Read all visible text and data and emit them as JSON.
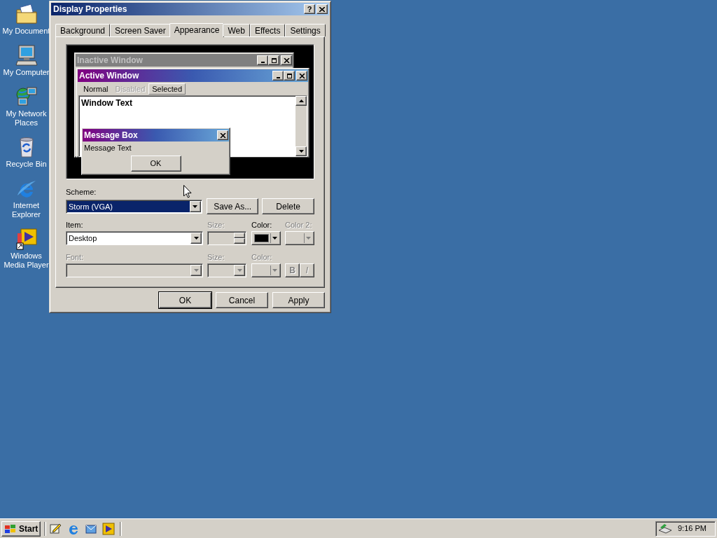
{
  "desktop_icons": [
    {
      "kind": "documents",
      "label": "My Document"
    },
    {
      "kind": "computer",
      "label": "My Computer"
    },
    {
      "kind": "network",
      "label": "My Network Places"
    },
    {
      "kind": "recycle",
      "label": "Recycle Bin"
    },
    {
      "kind": "browser",
      "label": "Internet Explorer"
    },
    {
      "kind": "media",
      "label": "Windows Media Player"
    }
  ],
  "dialog": {
    "title": "Display Properties",
    "help": "?",
    "tabs": [
      {
        "label": "Background",
        "selected": false
      },
      {
        "label": "Screen Saver",
        "selected": false
      },
      {
        "label": "Appearance",
        "selected": true
      },
      {
        "label": "Web",
        "selected": false
      },
      {
        "label": "Effects",
        "selected": false
      },
      {
        "label": "Settings",
        "selected": false
      }
    ],
    "preview": {
      "inactive_title": "Inactive Window",
      "active_title": "Active Window",
      "menu": [
        {
          "label": "Normal",
          "disabled": false,
          "selected": false
        },
        {
          "label": "Disabled",
          "disabled": true,
          "selected": false
        },
        {
          "label": "Selected",
          "disabled": false,
          "selected": true
        }
      ],
      "window_text": "Window Text",
      "message_title": "Message Box",
      "message_text": "Message Text",
      "message_button": "OK"
    },
    "scheme": {
      "label": "Scheme:",
      "value": "Storm (VGA)"
    },
    "scheme_buttons": [
      "Save As...",
      "Delete"
    ],
    "item": {
      "label": "Item:",
      "value": "Desktop"
    },
    "item_size": {
      "label": "Size:",
      "disabled": true
    },
    "item_color": {
      "label": "Color:",
      "color": "#000000",
      "disabled": false
    },
    "item_color2": {
      "label": "Color 2:",
      "disabled": true
    },
    "font": {
      "label": "Font:",
      "disabled": true
    },
    "font_size": {
      "label": "Size:",
      "disabled": true
    },
    "font_color": {
      "label": "Color:",
      "disabled": true
    },
    "bold_button": {
      "label": "B",
      "disabled": true
    },
    "italic_button": {
      "label": "I",
      "disabled": true
    },
    "buttons": [
      {
        "label": "OK",
        "default": true
      },
      {
        "label": "Cancel",
        "default": false
      },
      {
        "label": "Apply",
        "default": false
      }
    ]
  },
  "taskbar": {
    "start": "Start",
    "quick_launch": [
      {
        "kind": "desktop"
      },
      {
        "kind": "browser"
      },
      {
        "kind": "mail"
      },
      {
        "kind": "media"
      }
    ],
    "clock": "9:16 PM"
  }
}
